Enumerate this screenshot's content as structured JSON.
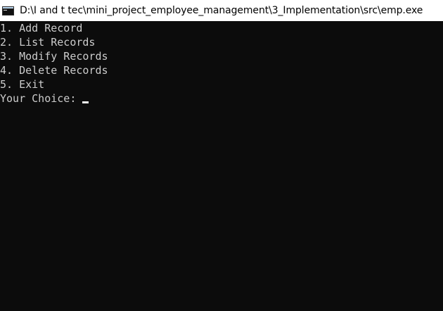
{
  "window": {
    "title": "D:\\I and t tec\\mini_project_employee_management\\3_Implementation\\src\\emp.exe"
  },
  "console": {
    "lines": [
      "1. Add Record",
      "2. List Records",
      "3. Modify Records",
      "4. Delete Records",
      "5. Exit"
    ],
    "prompt": "Your Choice: "
  },
  "colors": {
    "background": "#0c0c0c",
    "text": "#cccccc",
    "titlebar": "#ffffff"
  },
  "icons": {
    "app": "console-app-icon"
  }
}
